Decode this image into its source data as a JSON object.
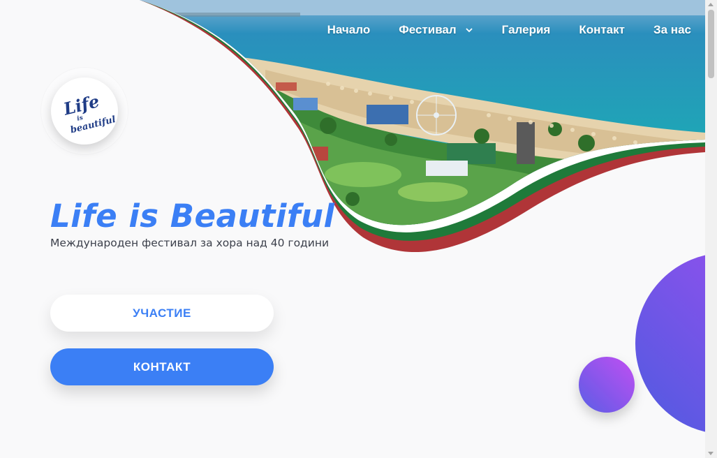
{
  "nav": {
    "items": [
      {
        "label": "Начало"
      },
      {
        "label": "Фестивал",
        "dropdown": true
      },
      {
        "label": "Галерия"
      },
      {
        "label": "Контакт"
      },
      {
        "label": "За нас"
      }
    ]
  },
  "logo": {
    "line1": "Life",
    "line2": "is",
    "line3": "beautiful"
  },
  "hero": {
    "title": "Life is Beautiful",
    "subtitle": "Международен фестивал за хора над 40 години"
  },
  "buttons": {
    "participation": "УЧАСТИЕ",
    "contact": "КОНТАКТ"
  },
  "colors": {
    "accent": "#3b7ff5",
    "flag_white": "#ffffff",
    "flag_green": "#1f7a3a",
    "flag_red": "#c33a3a",
    "bubble_start": "#4f5be0",
    "bubble_end": "#b04ef0"
  },
  "icons": {
    "chevron": "chevron-down-icon",
    "scroll_up": "arrow-up-icon",
    "scroll_down": "arrow-down-icon"
  }
}
